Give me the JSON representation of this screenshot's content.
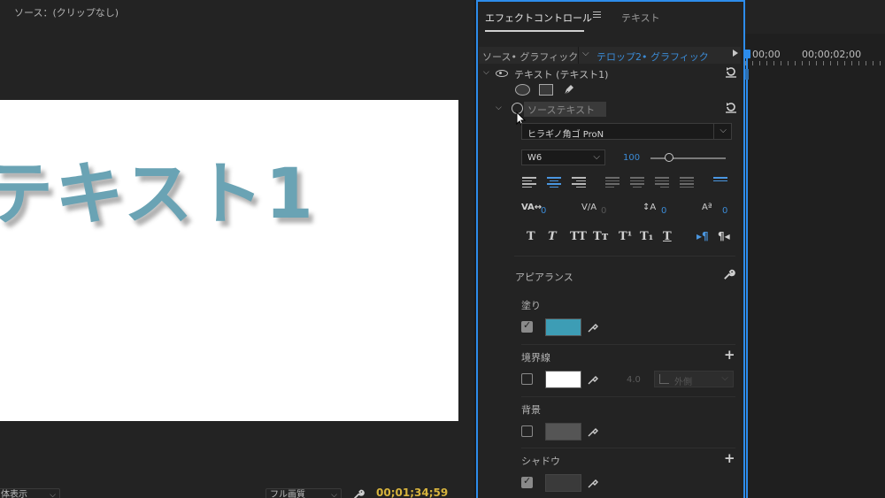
{
  "source_monitor": {
    "title": "ソース：(クリップなし)",
    "canvas_text": "テキスト1",
    "zoom_dropdown": "体表示",
    "resolution_dropdown": "フル画質",
    "timecode": "00;01;34;59"
  },
  "panel": {
    "tab_effect_controls": "エフェクトコントロール",
    "tab_text": "テキスト",
    "clip_source": "ソース• グラフィック",
    "clip_sequence": "テロップ2• グラフィック",
    "timeline_time_1": "00;00",
    "timeline_time_2": "00;00;02;00"
  },
  "text_layer": {
    "label": "テキスト (テキスト1)",
    "source_text_label": "ソーステキスト",
    "font_family": "ヒラギノ角ゴ ProN",
    "font_weight": "W6",
    "font_size": "100",
    "tracking_value": "0",
    "kerning_value": "0",
    "leading_value": "0",
    "baseline_value": "0"
  },
  "appearance": {
    "title": "アピアランス",
    "fill_label": "塗り",
    "fill_checked": true,
    "fill_color": "#3d9db5",
    "stroke_label": "境界線",
    "stroke_checked": false,
    "stroke_color": "#ffffff",
    "stroke_width": "4.0",
    "stroke_position": "外側",
    "background_label": "背景",
    "background_checked": false,
    "background_color": "#555555",
    "shadow_label": "シャドウ",
    "shadow_checked": true,
    "shadow_color": "#3a3a3a"
  },
  "colors": {
    "accent": "#2d8ceb",
    "value_blue": "#3b8bd6",
    "timecode": "#d7b33d"
  }
}
